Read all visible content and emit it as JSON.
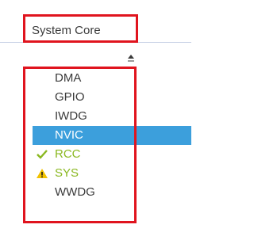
{
  "category": {
    "label": "System Core"
  },
  "peripherals": [
    {
      "label": "DMA",
      "status": "none"
    },
    {
      "label": "GPIO",
      "status": "none"
    },
    {
      "label": "IWDG",
      "status": "none"
    },
    {
      "label": "NVIC",
      "status": "selected"
    },
    {
      "label": "RCC",
      "status": "ok",
      "icon": "check-icon"
    },
    {
      "label": "SYS",
      "status": "warning",
      "icon": "warning-icon"
    },
    {
      "label": "WWDG",
      "status": "none"
    }
  ],
  "colors": {
    "highlight_box": "#e0141e",
    "selected_bg": "#3c9fdc",
    "ok_text": "#8ab820",
    "warning_icon": "#f2c200"
  },
  "icons": {
    "sort": "sort-ascending-icon"
  }
}
